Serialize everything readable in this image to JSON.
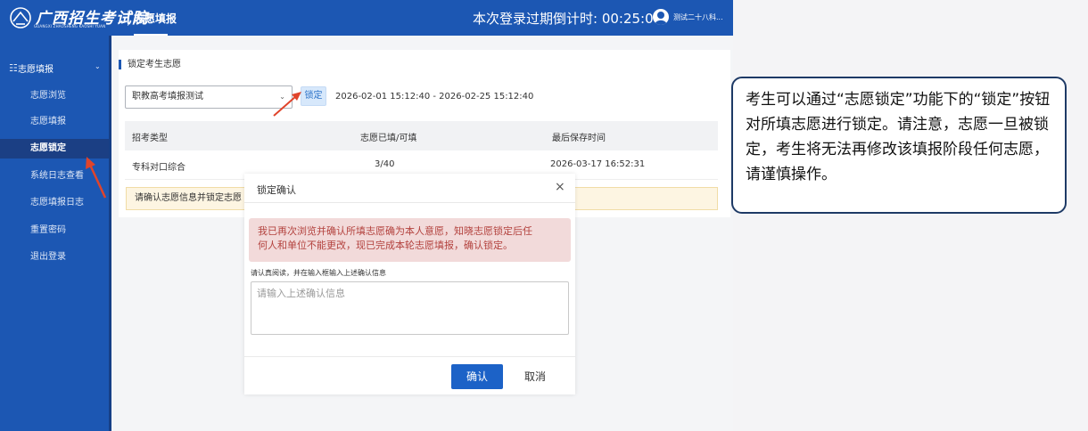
{
  "header": {
    "logo_title": "广西招生考试院",
    "logo_sub": "GUANGXI ZHAOSHENG KAOSHI YUAN",
    "module": "志愿填报",
    "countdown": "本次登录过期倒计时: 00:25:07",
    "user": "测试二十八科..."
  },
  "sidebar": {
    "group": "志愿填报",
    "items": [
      {
        "label": "志愿浏览"
      },
      {
        "label": "志愿填报"
      },
      {
        "label": "志愿锁定"
      },
      {
        "label": "系统日志查看"
      },
      {
        "label": "志愿填报日志"
      },
      {
        "label": "重置密码"
      },
      {
        "label": "退出登录"
      }
    ],
    "active_index": 2
  },
  "panel": {
    "title": "锁定考生志愿",
    "select_value": "职教高考填报测试",
    "lock_label": "锁定",
    "period": "2026-02-01 15:12:40 - 2026-02-25 15:12:40",
    "columns": [
      "招考类型",
      "志愿已填/可填",
      "最后保存时间"
    ],
    "rows": [
      [
        "专科对口综合",
        "3/40",
        "2026-03-17 16:52:31"
      ]
    ],
    "notice": "请确认志愿信息并锁定志愿"
  },
  "modal": {
    "title": "锁定确认",
    "close": "×",
    "alert_line1": "我已再次浏览并确认所填志愿确为本人意愿，知晓志愿锁定后任",
    "alert_line2": "何人和单位不能更改，现已完成本轮志愿填报，确认锁定。",
    "prompt": "请认真阅读，并在输入框输入上述确认信息",
    "input_placeholder": "请输入上述确认信息",
    "input_value": "",
    "ok": "确认",
    "cancel": "取消"
  },
  "callout": {
    "text": "考生可以通过“志愿锁定”功能下的“锁定”按钮对所填志愿进行锁定。请注意，志愿一旦被锁定，考生将无法再修改该填报阶段任何志愿，请谨慎操作。"
  },
  "colors": {
    "primary": "#1c57b3",
    "sidebar_active": "#1b3f84",
    "alert_bg": "#f2dada",
    "alert_text": "#b3423e",
    "notice_bg": "#fdf5e2",
    "arrow": "#e0442b"
  }
}
